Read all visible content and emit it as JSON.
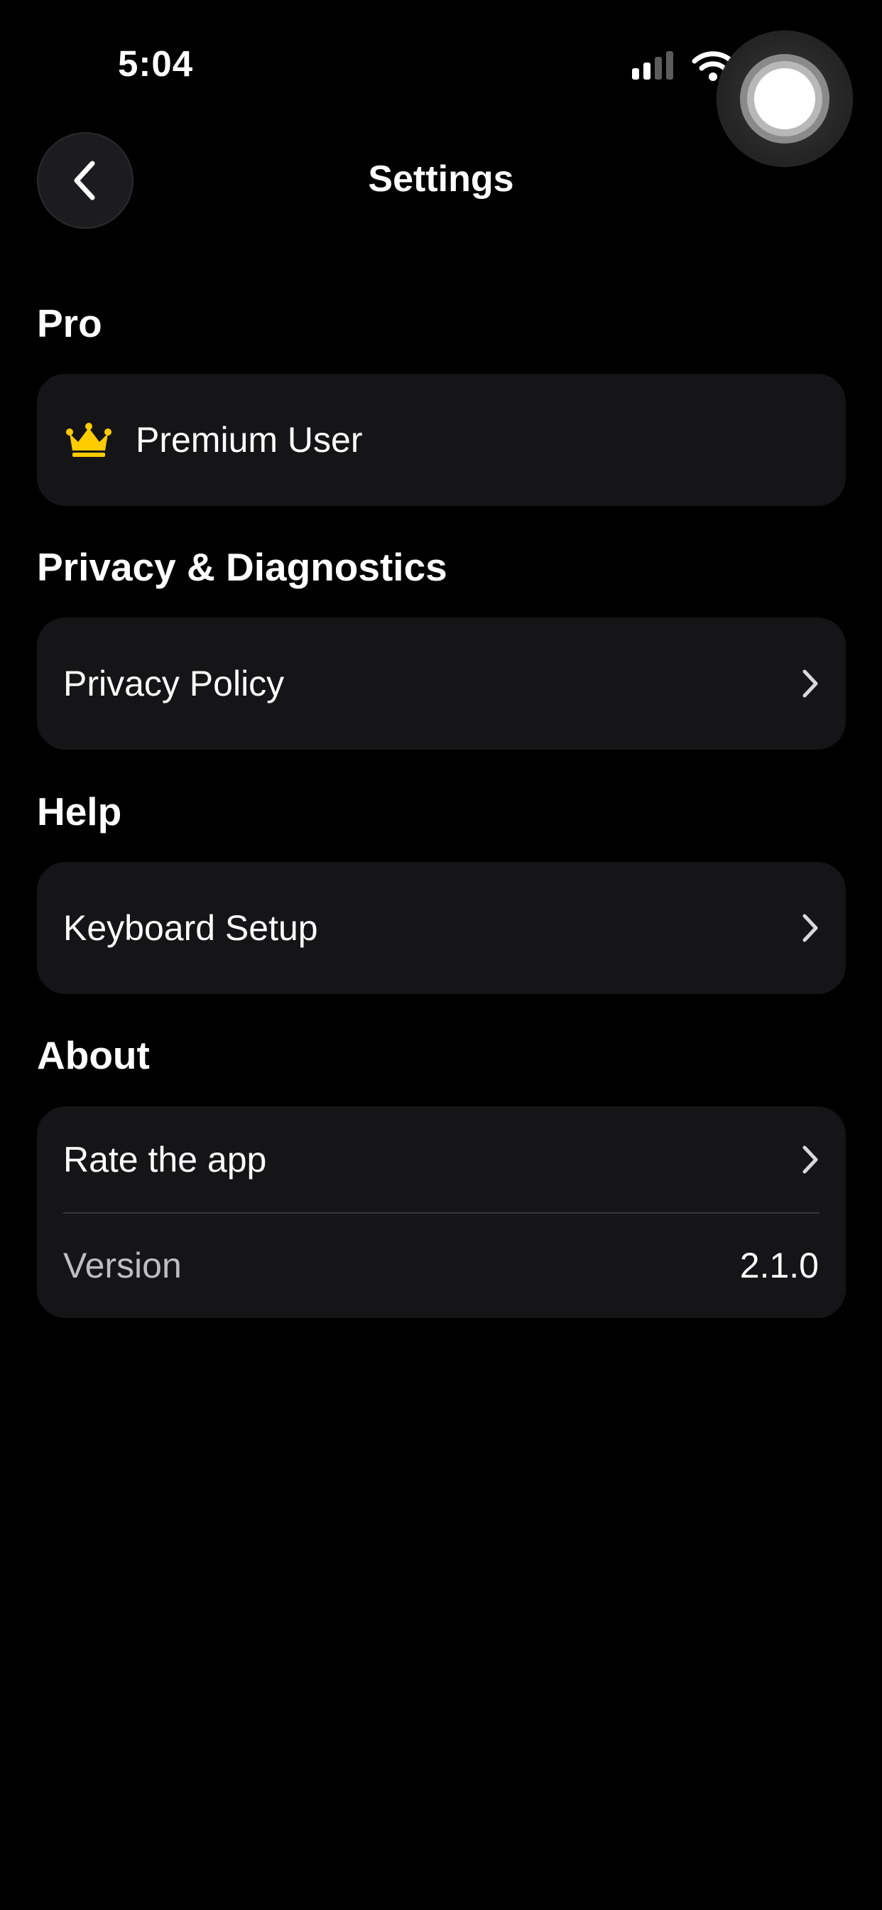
{
  "status_bar": {
    "time": "5:04"
  },
  "nav": {
    "title": "Settings",
    "back_icon": "chevron-left-icon"
  },
  "sections": {
    "pro": {
      "header": "Pro",
      "premium_label": "Premium User",
      "icon": "crown-icon",
      "icon_color": "#FFCC00"
    },
    "privacy": {
      "header": "Privacy & Diagnostics",
      "privacy_policy_label": "Privacy Policy"
    },
    "help": {
      "header": "Help",
      "keyboard_setup_label": "Keyboard Setup"
    },
    "about": {
      "header": "About",
      "rate_label": "Rate the app",
      "version_label": "Version",
      "version_value": "2.1.0"
    }
  },
  "colors": {
    "background": "#000000",
    "card": "#151517",
    "text": "#FFFFFF",
    "muted_text": "#BDBDC2",
    "accent_crown": "#FFCC00"
  }
}
